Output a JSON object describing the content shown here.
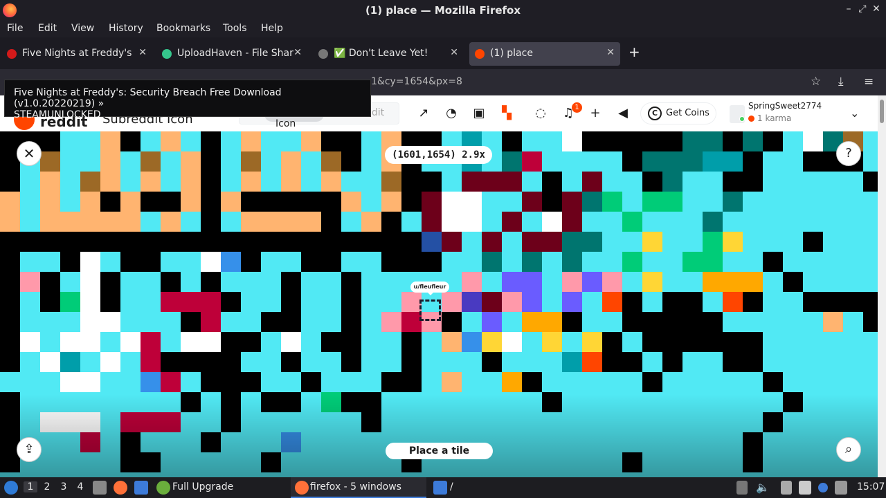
{
  "window": {
    "title": "(1) place — Mozilla Firefox",
    "controls": [
      "–",
      "⤢",
      "✕"
    ]
  },
  "menu": [
    "File",
    "Edit",
    "View",
    "History",
    "Bookmarks",
    "Tools",
    "Help"
  ],
  "tabs": [
    {
      "label": "Five Nights at Freddy's:",
      "favicon_color": "#d31a1a",
      "active": false
    },
    {
      "label": "UploadHaven - File Sharing",
      "favicon_color": "#35c68c",
      "active": false
    },
    {
      "label": "✅ Don't Leave Yet!",
      "favicon_color": "#777777",
      "active": false
    },
    {
      "label": "(1) place",
      "favicon_color": "#ff4500",
      "active": true
    }
  ],
  "new_tab": "+",
  "tab_close": "✕",
  "url_fragment": "1&cy=1654&px=8",
  "tooltip": {
    "line1": "Five Nights at Freddy's: Security Breach Free Download (v1.0.20220219) »",
    "line2": "STEAMUNLOCKED"
  },
  "reddit": {
    "logo_text": "reddit",
    "subreddit": "Subreddit Icon",
    "search_chip": "Icon",
    "search_placeholder": "ddit",
    "notification_count": "1",
    "coins_label": "Get Coins",
    "username": "SpringSweet2774",
    "karma": "1 karma"
  },
  "place": {
    "coordinates": "(1601,1654) 2.9x",
    "user_tag": "u/fleufleur",
    "place_button": "Place a tile",
    "close_symbol": "✕",
    "help_symbol": "?"
  },
  "palette": {
    "cyan": "#51e9f4",
    "black": "#000000",
    "white": "#ffffff",
    "tan": "#ffb470",
    "brown": "#9c6926",
    "darkbrown": "#6d482f",
    "maroon": "#6d001a",
    "red": "#be0039",
    "orange": "#ff4500",
    "amber": "#ffa800",
    "yellow": "#ffd635",
    "green": "#00cc78",
    "darkteal": "#00756f",
    "teal": "#009eaa",
    "blue": "#2450a4",
    "lightblue": "#3690ea",
    "indigo": "#493ac1",
    "periwinkle": "#6a5cff",
    "lavender": "#94b3ff",
    "purple": "#811e9f",
    "lilac": "#e4abff",
    "pink": "#ff99aa",
    "gray": "#898d90",
    "darkgray": "#515252",
    "lightgray": "#d4d7d9"
  },
  "pixels": [
    "KKKCCNKCNCKCNCCNKKCNKKCTCKCCWKKKKKDDKDKCWDBCCKKCRCKCTBBC",
    "KCBCCNCBCNKCBCNCBKCNKCCTCDRCCCCKDDDTTKCCKKKCCKKCCBKCCKKC",
    "KCNCBNCNCNKCNCNCNCCBKKCMMMCKCMCCKDCCKKCCCCCKWCKKKCCCKCCKC",
    "NCNCNKNKKNKNKKKKKNCNKMWWCCMKMDGCGGCCDCCCCCCCCCCCCCCNCCC",
    "NCNNNNNCNCKCNNNNKCNKCMWWCMCWMCCGCCCDCCCCCCCCCCCCCCCCCCC",
    "KKKKKKKKKKKKKKKKKKKKKUMCMCMMDDCCYCCGYCCCKCCCCCCCCCCCCCC",
    "KCCKWCKKCCWLKCCKKCCKKKCCDCDCDCCGCCGGCCKCCCCCCCCCCCCCCC",
    "KPKCWKCCKCKCCCKCCKCCCCCPCVVCPVPCYCCAAACKCCCCCCCCCCCCCCC",
    "KCKGWKCCRRRKCCKCCKCCPCPIMPVCVCOKCKKCOKCCKKKKCCCCCCCCCC",
    "KCCCWWCCCKRCCKKCCKCPRPKCVCAAKCCKKKKKCCCCCNCKCCCCCCCCCC",
    "KWCWWCWRCWWKKCWCKKCCKCNLYWCYCYKCKKKKKKCCCCCCCKKCCCCCCI",
    "KCWTCWCRKKKKCCKCCKCCKCCCKCCCTOKKCKCCKKCCCCCCNNKNNNCCCCC",
    "CCCWWCCLRCKKKCCKCCCKKCNCCAKCCCCCKCCCCCKCCCCCCCTCNWWCCCC",
    "KCCCCCCCCKCKCKKCGKKCCCCCCCCKCCCCCCCCCCCKCCCCCCCCNCWKCCC",
    "KCWWWCRRRCCKCCCCCCKCCCCCCCCCCCCCCCCCCCKCCCCCCCCCCCWCCCC",
    "KCCCRCKCCCKCCCLCCCCCCCCCCCCCCCCCCCCCCKCCCCCCCCCCCCCCCC",
    "KCCCCCKKCCCCCKCCCCCCKCCCCCCCCCCKCCCCCKCCCCCCCCCCCCCCCC"
  ],
  "taskbar": {
    "workspaces": [
      "1",
      "2",
      "3",
      "4"
    ],
    "upgrade_label": "Full Upgrade",
    "firefox_label": "firefox - 5 windows",
    "folder_label": "/",
    "clock": "15:07"
  }
}
